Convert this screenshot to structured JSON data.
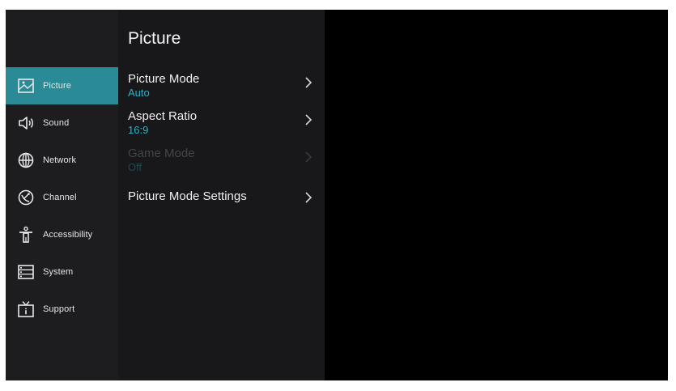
{
  "sidebar": {
    "items": [
      {
        "label": "Picture",
        "icon": "picture-icon",
        "active": true
      },
      {
        "label": "Sound",
        "icon": "speaker-icon",
        "active": false
      },
      {
        "label": "Network",
        "icon": "globe-icon",
        "active": false
      },
      {
        "label": "Channel",
        "icon": "satellite-dish-icon",
        "active": false
      },
      {
        "label": "Accessibility",
        "icon": "accessibility-person-icon",
        "active": false
      },
      {
        "label": "System",
        "icon": "system-list-icon",
        "active": false
      },
      {
        "label": "Support",
        "icon": "tv-info-icon",
        "active": false
      }
    ]
  },
  "panel": {
    "title": "Picture",
    "items": [
      {
        "label": "Picture Mode",
        "value": "Auto",
        "enabled": true
      },
      {
        "label": "Aspect Ratio",
        "value": "16:9",
        "enabled": true
      },
      {
        "label": "Game Mode",
        "value": "Off",
        "enabled": false
      },
      {
        "label": "Picture Mode Settings",
        "value": "",
        "enabled": true
      }
    ]
  },
  "colors": {
    "accent": "#2a8a96",
    "value_text": "#2ab3c6",
    "sidebar_bg": "#1d1d1f",
    "panel_bg": "#18181a",
    "screen_bg": "#000000"
  }
}
